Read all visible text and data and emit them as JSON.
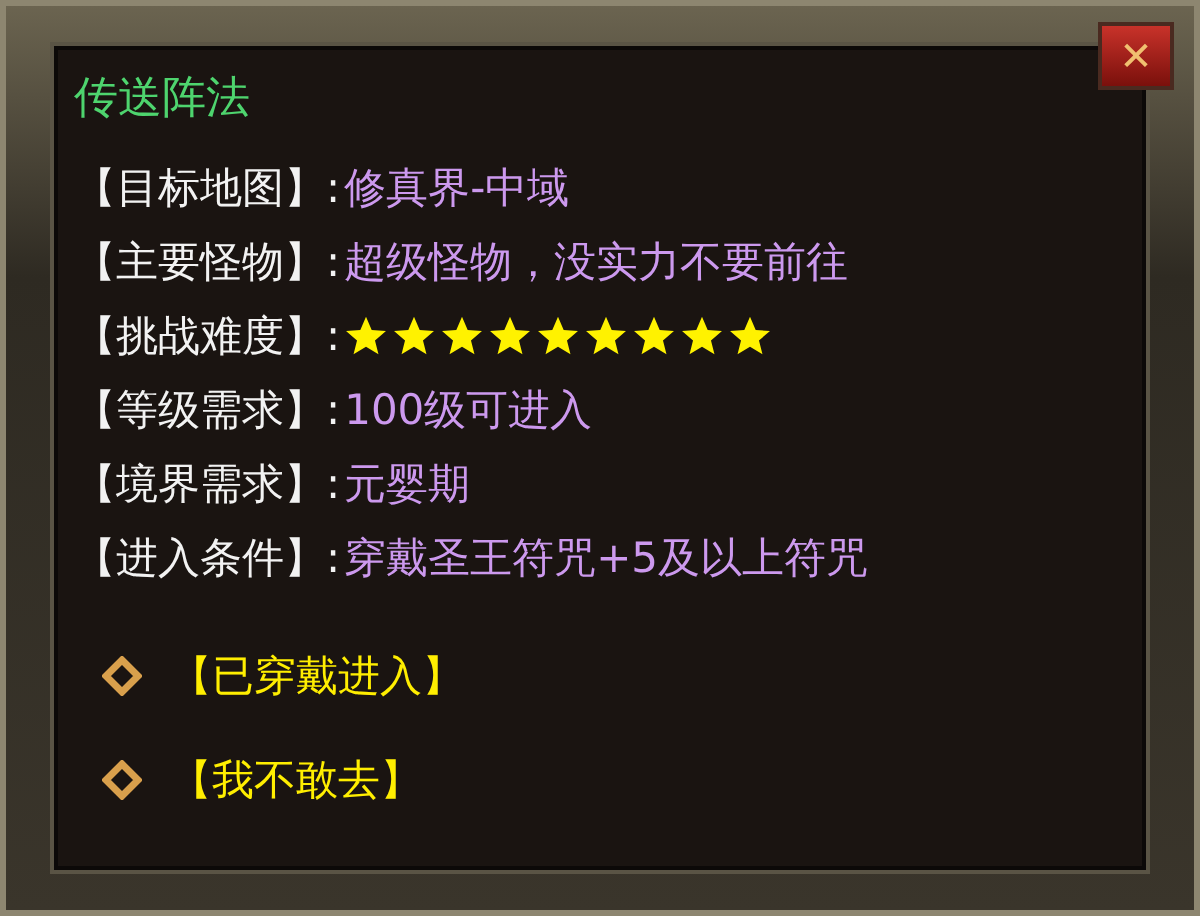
{
  "dialog": {
    "title": "传送阵法",
    "close": "✕"
  },
  "rows": [
    {
      "kind": "text",
      "label": "【目标地图】:",
      "value": "修真界-中域"
    },
    {
      "kind": "text",
      "label": "【主要怪物】:",
      "value": "超级怪物，没实力不要前往"
    },
    {
      "kind": "stars",
      "label": "【挑战难度】:",
      "stars": 9
    },
    {
      "kind": "text",
      "label": "【等级需求】:",
      "value": "100级可进入"
    },
    {
      "kind": "text",
      "label": "【境界需求】:",
      "value": "元婴期"
    },
    {
      "kind": "text",
      "label": "【进入条件】:",
      "value": "穿戴圣王符咒+5及以上符咒"
    }
  ],
  "options": [
    {
      "label": "【已穿戴进入】"
    },
    {
      "label": "【我不敢去】"
    }
  ]
}
